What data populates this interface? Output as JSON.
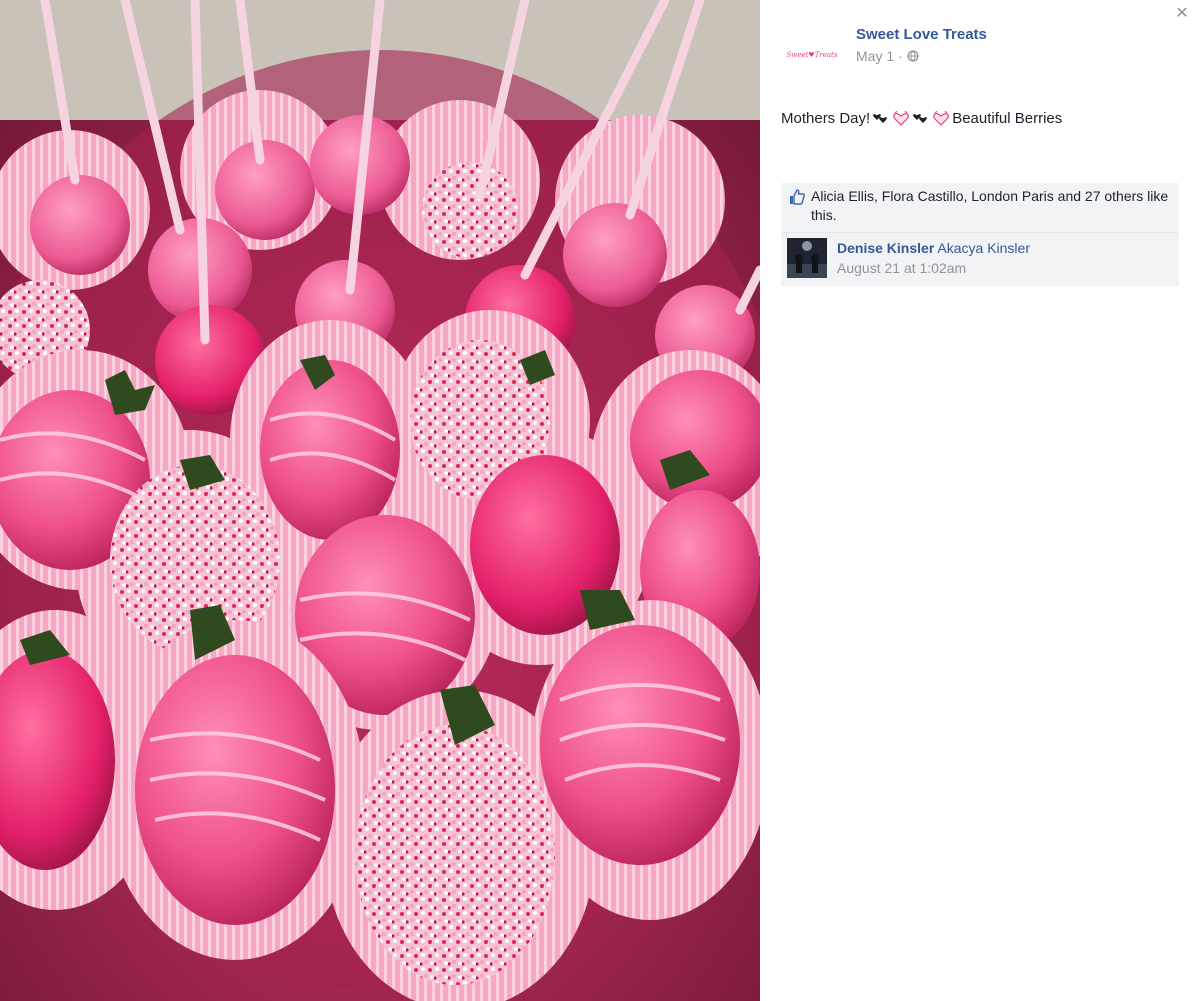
{
  "photo": {
    "icon": "photo-strawberries-cake-pops"
  },
  "close": {
    "label": "✕",
    "icon": "close-icon"
  },
  "post": {
    "page_name": "Sweet Love Treats",
    "date": "May 1",
    "separator": "·",
    "privacy_icon": "globe-icon",
    "text_part1": "Mothers Day!",
    "text_part2": "Beautiful Berries",
    "avatar_logo": "Sweet Love Treats"
  },
  "likes": {
    "icon": "like-icon",
    "text": "Alicia Ellis, Flora Castillo, London Paris and 27 others like this."
  },
  "comment": {
    "author": "Denise Kinsler",
    "tagged": "Akacya Kinsler",
    "timestamp": "August 21 at 1:02am"
  },
  "colors": {
    "link": "#365899",
    "meta": "#90949c",
    "text": "#1d2129",
    "panel": "#f2f3f5",
    "pink": "#e8437a"
  }
}
